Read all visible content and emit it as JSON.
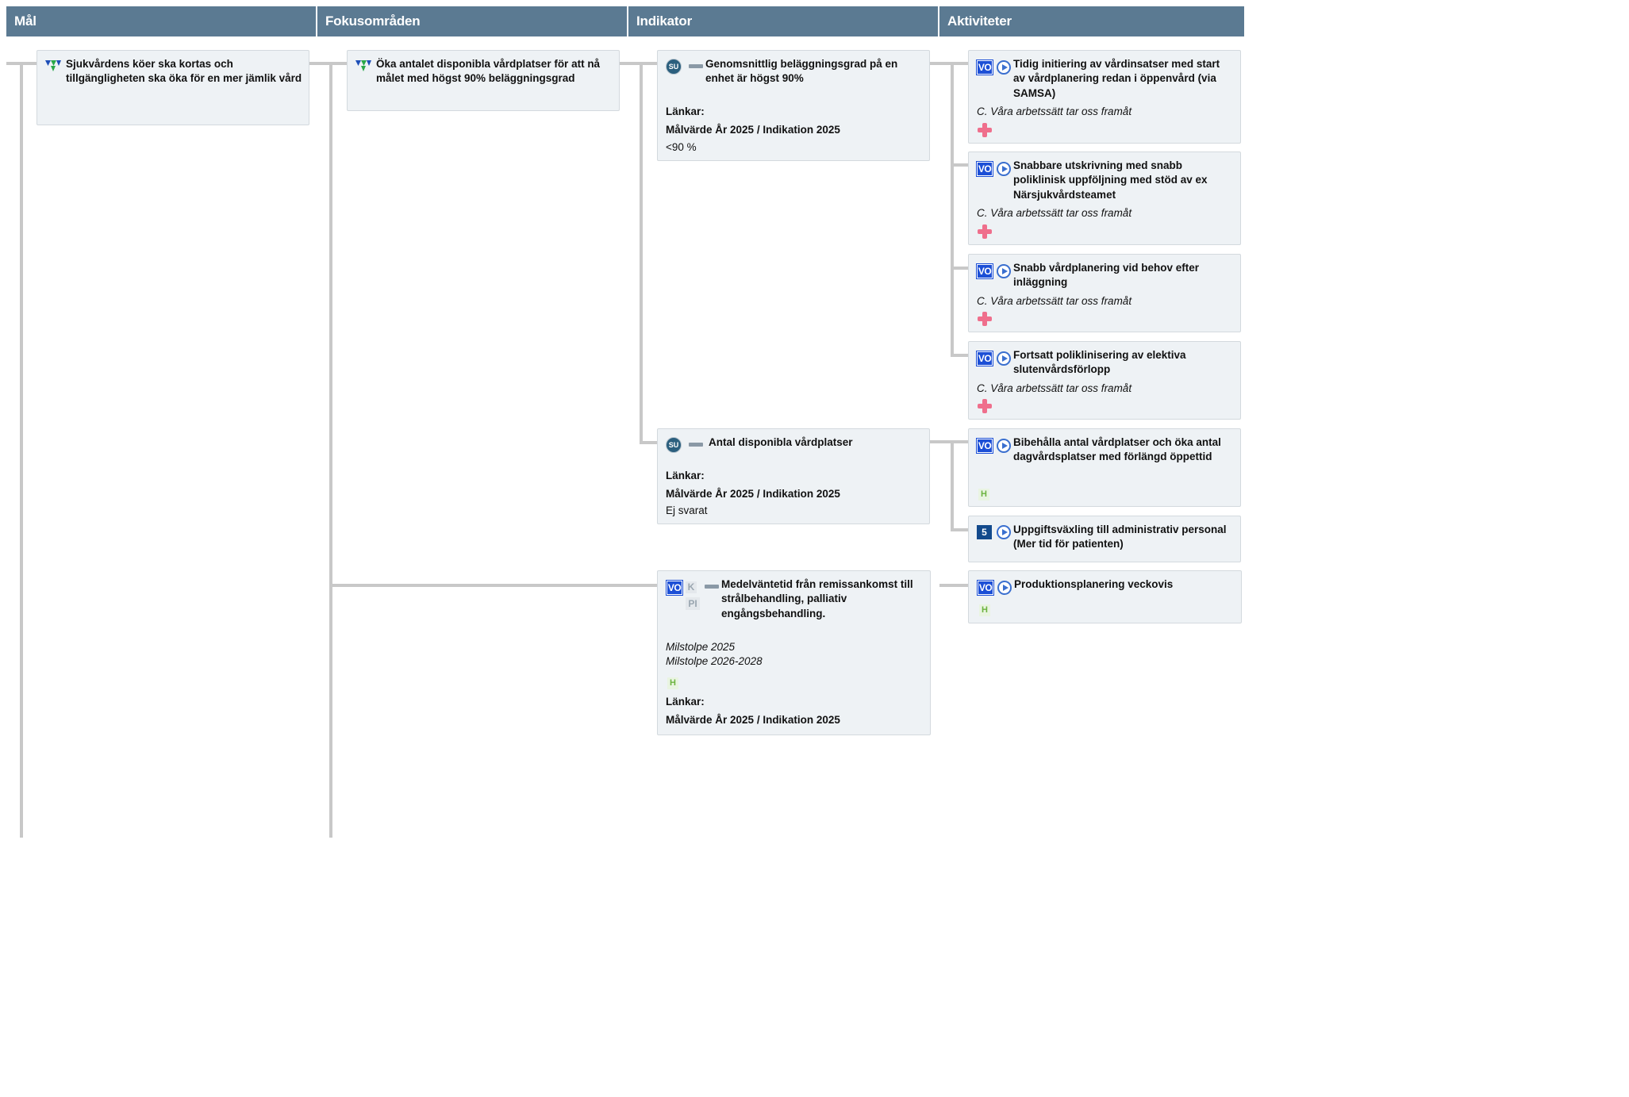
{
  "headers": {
    "mal": "Mål",
    "fokus": "Fokusområden",
    "indikator": "Indikator",
    "aktiviteter": "Aktiviteter"
  },
  "mal": {
    "title": "Sjukvårdens köer ska kortas och tillgängligheten ska öka för en mer jämlik vård"
  },
  "fokus": {
    "title": "Öka antalet disponibla vårdplatser för att nå målet med högst 90% beläggningsgrad"
  },
  "indikatorer": [
    {
      "badge": "SU",
      "title": "Genomsnittlig beläggningsgrad på en enhet är högst 90%",
      "links_label": "Länkar:",
      "target_label": "Målvärde År 2025 / Indikation 2025",
      "target_value": "<90 %"
    },
    {
      "badge": "SU",
      "title": "Antal disponibla vårdplatser",
      "links_label": "Länkar:",
      "target_label": "Målvärde År 2025 / Indikation 2025",
      "target_value": "Ej svarat"
    },
    {
      "badge": "VO",
      "k_badge": "K",
      "pi_badge": "PI",
      "title": "Medelväntetid från remissankomst till strålbehandling, palliativ engångsbehandling.",
      "milestone1": "Milstolpe 2025",
      "milestone2": "Milstolpe 2026-2028",
      "h_badge": "H",
      "links_label": "Länkar:",
      "target_label": "Målvärde År 2025 / Indikation 2025"
    }
  ],
  "aktiviteter": [
    {
      "badge": "VO",
      "title": "Tidig initiering av vårdinsatser med start av vårdplanering redan i öppenvård (via SAMSA)",
      "subtitle": "C. Våra arbetssätt tar oss framåt"
    },
    {
      "badge": "VO",
      "title": "Snabbare utskrivning med snabb poliklinisk uppföljning med stöd av ex Närsjukvårdsteamet",
      "subtitle": "C. Våra arbetssätt tar oss framåt"
    },
    {
      "badge": "VO",
      "title": "Snabb vårdplanering vid behov efter inläggning",
      "subtitle": "C. Våra arbetssätt tar oss framåt"
    },
    {
      "badge": "VO",
      "title": "Fortsatt poliklinisering av elektiva slutenvårdsförlopp",
      "subtitle": "C. Våra arbetssätt tar oss framåt"
    },
    {
      "badge": "VO",
      "title": "Bibehålla antal vårdplatser och öka antal dagvårdsplatser med förlängd öppettid",
      "h_badge": "H"
    },
    {
      "badge": "5",
      "title": "Uppgiftsväxling till administrativ personal (Mer tid för patienten)"
    },
    {
      "badge": "VO",
      "title": "Produktionsplanering veckovis",
      "h_badge": "H"
    }
  ],
  "colors": {
    "header_bg": "#5b7a92",
    "card_bg": "#eef2f5",
    "vo_blue": "#1c4fd6",
    "cross_pink": "#ef6f8c",
    "h_green": "#6cb33f",
    "connector": "#c8c8c8"
  }
}
